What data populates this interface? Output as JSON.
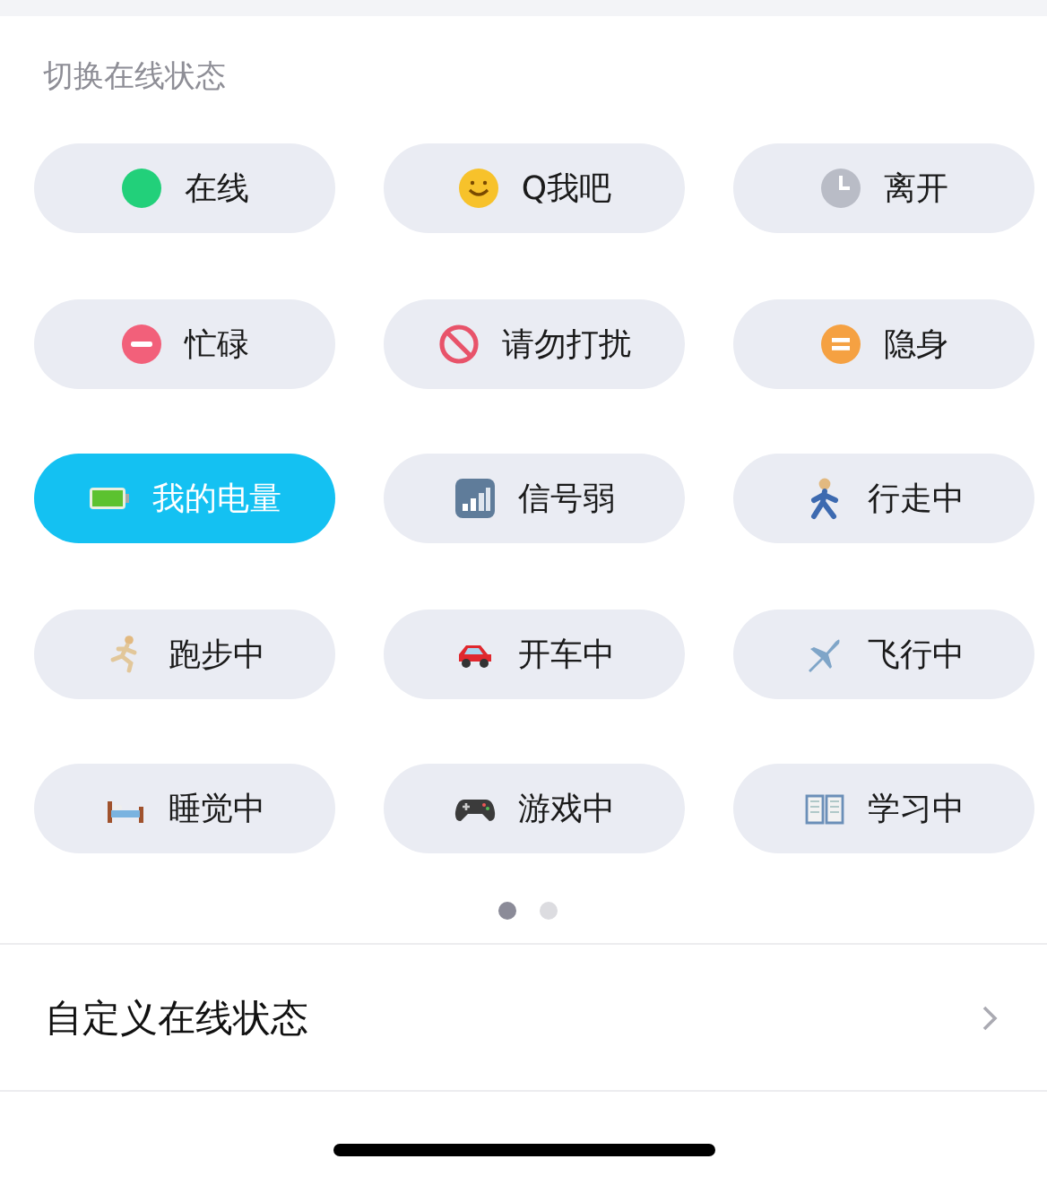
{
  "section_title": "切换在线状态",
  "statuses": [
    {
      "label": "在线",
      "kind": "online",
      "selected": false
    },
    {
      "label": "Q我吧",
      "kind": "smile",
      "selected": false
    },
    {
      "label": "离开",
      "kind": "clock",
      "selected": false
    },
    {
      "label": "忙碌",
      "kind": "busy",
      "selected": false
    },
    {
      "label": "请勿打扰",
      "kind": "nodisturb",
      "selected": false
    },
    {
      "label": "隐身",
      "kind": "hidden",
      "selected": false
    },
    {
      "label": "我的电量",
      "kind": "battery",
      "selected": true
    },
    {
      "label": "信号弱",
      "kind": "signal",
      "selected": false
    },
    {
      "label": "行走中",
      "kind": "walk",
      "selected": false
    },
    {
      "label": "跑步中",
      "kind": "run",
      "selected": false
    },
    {
      "label": "开车中",
      "kind": "car",
      "selected": false
    },
    {
      "label": "飞行中",
      "kind": "plane",
      "selected": false
    },
    {
      "label": "睡觉中",
      "kind": "bed",
      "selected": false
    },
    {
      "label": "游戏中",
      "kind": "gamepad",
      "selected": false
    },
    {
      "label": "学习中",
      "kind": "book",
      "selected": false
    }
  ],
  "pages": [
    {
      "selected": true
    },
    {
      "selected": false
    }
  ],
  "custom_row": {
    "label": "自定义在线状态"
  }
}
